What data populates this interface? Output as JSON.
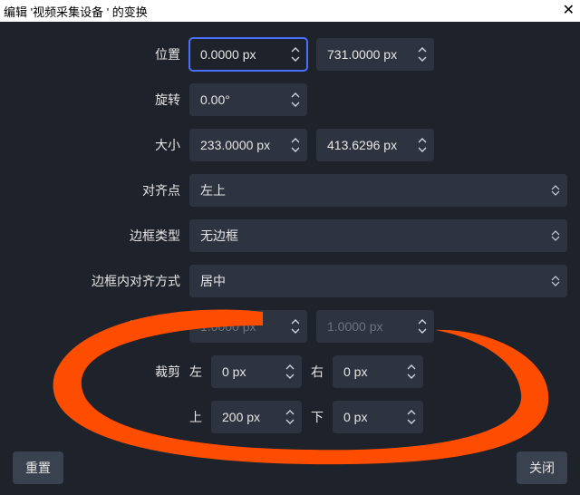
{
  "title": "编辑 '视频采集设备 ' 的变换",
  "labels": {
    "position": "位置",
    "rotation": "旋转",
    "size": "大小",
    "anchor": "对齐点",
    "boxType": "边框类型",
    "boxAlign": "边框内对齐方式",
    "boxSize": "边框大小",
    "crop": "裁剪",
    "left": "左",
    "right": "右",
    "top": "上",
    "bottom": "下"
  },
  "values": {
    "posX": "0.0000 px",
    "posY": "731.0000 px",
    "rotation": "0.00°",
    "sizeW": "233.0000 px",
    "sizeH": "413.6296 px",
    "anchor": "左上",
    "boxType": "无边框",
    "boxAlign": "居中",
    "boxW": "1.0000 px",
    "boxH": "1.0000 px",
    "cropLeft": "0 px",
    "cropRight": "0 px",
    "cropTop": "200 px",
    "cropBottom": "0 px"
  },
  "buttons": {
    "reset": "重置",
    "close": "关闭"
  },
  "closeGlyph": "✕"
}
